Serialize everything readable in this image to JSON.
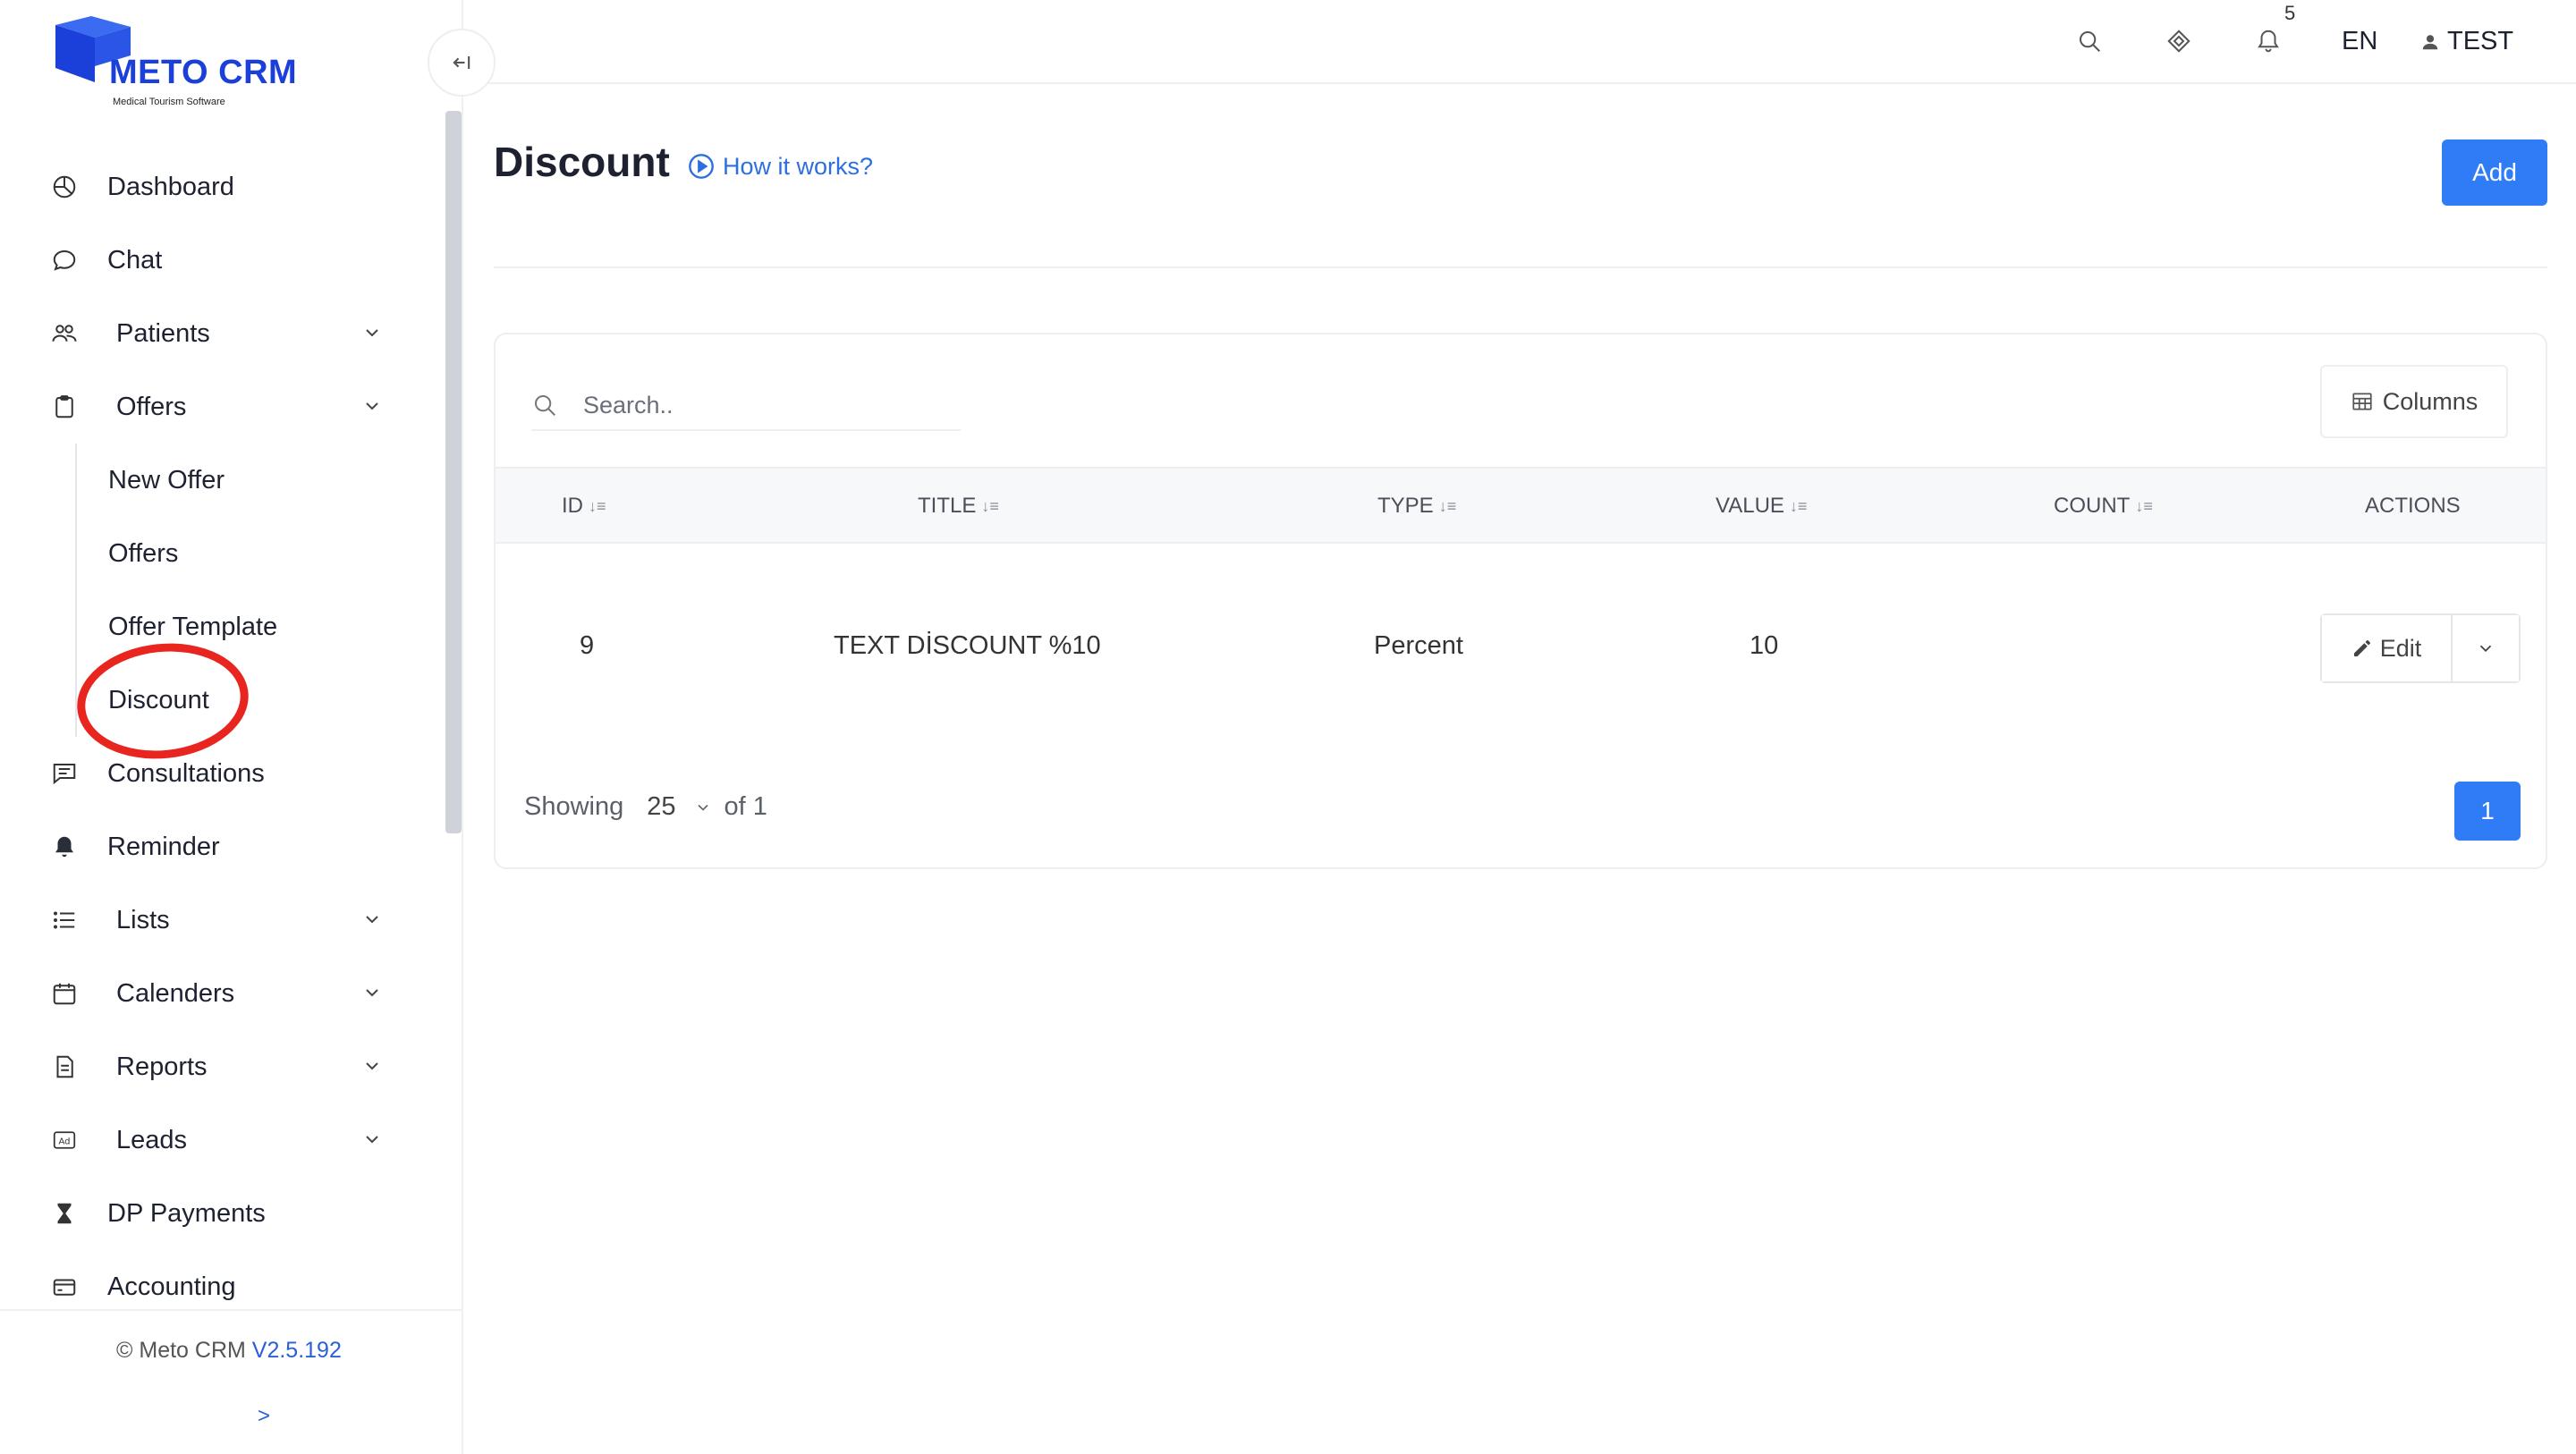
{
  "app": {
    "logo_text": "METO CRM",
    "logo_subtitle": "Medical Tourism Software",
    "brand_color": "#1b3fd9",
    "accent_color": "#2f7cf6",
    "highlight_color": "#e8261f"
  },
  "sidebar": {
    "items": [
      {
        "label": "Dashboard",
        "icon": "dashboard-icon"
      },
      {
        "label": "Chat",
        "icon": "chat-icon"
      },
      {
        "label": "Patients",
        "icon": "users-icon",
        "expandable": true
      },
      {
        "label": "Offers",
        "icon": "clipboard-icon",
        "expandable": true,
        "expanded": true,
        "children": [
          {
            "label": "New Offer"
          },
          {
            "label": "Offers"
          },
          {
            "label": "Offer Template"
          },
          {
            "label": "Discount",
            "active": true
          }
        ]
      },
      {
        "label": "Consultations",
        "icon": "consultation-icon"
      },
      {
        "label": "Reminder",
        "icon": "bell-icon"
      },
      {
        "label": "Lists",
        "icon": "list-icon",
        "expandable": true
      },
      {
        "label": "Calenders",
        "icon": "calendar-icon",
        "expandable": true
      },
      {
        "label": "Reports",
        "icon": "report-icon",
        "expandable": true
      },
      {
        "label": "Leads",
        "icon": "ad-icon",
        "expandable": true
      },
      {
        "label": "DP Payments",
        "icon": "hourglass-icon"
      },
      {
        "label": "Accounting",
        "icon": "card-icon"
      }
    ],
    "footer": {
      "copyright": "© Meto CRM",
      "version": "V2.5.192",
      "expand": ">"
    }
  },
  "topbar": {
    "notification_count": "5",
    "language": "EN",
    "user_name": "TEST"
  },
  "main": {
    "title": "Discount",
    "how_it_works": "How it works?",
    "add_label": "Add",
    "search_placeholder": "Search..",
    "columns_label": "Columns",
    "table": {
      "headers": [
        "ID",
        "TITLE",
        "TYPE",
        "VALUE",
        "COUNT",
        "ACTIONS"
      ],
      "rows": [
        {
          "id": "9",
          "title": "TEXT DİSCOUNT %10",
          "type": "Percent",
          "value": "10",
          "count": "",
          "action_label": "Edit"
        }
      ]
    },
    "pagination": {
      "showing_label": "Showing",
      "page_size": "25",
      "of_label": "of 1",
      "current_page": "1"
    }
  }
}
